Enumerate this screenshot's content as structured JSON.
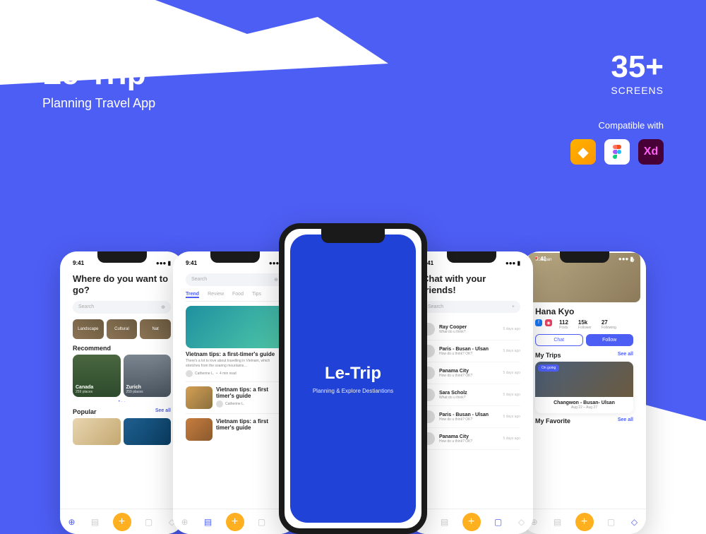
{
  "header": {
    "title": "Le-Trip",
    "subtitle": "Planning Travel App"
  },
  "badge": {
    "count": "35+",
    "label": "SCREENS"
  },
  "compat": {
    "label": "Compatible with",
    "tools": [
      "Sketch",
      "Figma",
      "Xd"
    ]
  },
  "statusTime": "9:41",
  "screen1": {
    "heading": "Where do you want to go?",
    "searchPlaceholder": "Search",
    "chips": [
      "Landscape",
      "Cultural",
      "Nat"
    ],
    "recommend": {
      "label": "Recommend",
      "items": [
        {
          "title": "Canada",
          "sub": "259 places"
        },
        {
          "title": "Zurich",
          "sub": "259 places"
        }
      ]
    },
    "popular": {
      "label": "Popular",
      "seeAll": "See all"
    }
  },
  "screen2": {
    "searchPlaceholder": "Search",
    "tabs": [
      "Trend",
      "Review",
      "Food",
      "Tips"
    ],
    "article": {
      "title": "Vietnam tips: a first-timer's guide",
      "desc": "There's a lot to love about travelling in Vietnam, which stretches from the soaring mountains…",
      "author": "Catherine L.",
      "read": "4 min read"
    },
    "rows": [
      {
        "title": "Vietnam tips: a first timer's guide",
        "author": "Catherine L."
      },
      {
        "title": "Vietnam tips: a first timer's guide"
      }
    ]
  },
  "screen3": {
    "title": "Le-Trip",
    "subtitle": "Planning & Explore Destiantions"
  },
  "screen4": {
    "heading": "Chat with your friends!",
    "searchPlaceholder": "Search",
    "chats": [
      {
        "name": "Ray Cooper",
        "msg": "What do u think?",
        "time": "5 days ago"
      },
      {
        "name": "Paris - Busan - Ulsan",
        "msg": "How do u think? OK?",
        "time": "5 days ago"
      },
      {
        "name": "Panama City",
        "msg": "How do u think? OK?",
        "time": "5 days ago"
      },
      {
        "name": "Sara Scholz",
        "msg": "What do u think?",
        "time": "5 days ago"
      },
      {
        "name": "Paris - Busan - Ulsan",
        "msg": "How do u think? OK?",
        "time": "5 days ago"
      },
      {
        "name": "Panama City",
        "msg": "How do u think? OK?",
        "time": "5 days ago"
      }
    ]
  },
  "screen5": {
    "location": "Japan",
    "name": "Hana Kyo",
    "stats": [
      {
        "n": "112",
        "l": "Posts"
      },
      {
        "n": "15k",
        "l": "Follower"
      },
      {
        "n": "27",
        "l": "Following"
      }
    ],
    "chatBtn": "Chat",
    "followBtn": "Follow",
    "myTrips": {
      "label": "My Trips",
      "seeAll": "See all"
    },
    "trip": {
      "status": "On going",
      "title": "Changwon - Busan- Ulsan",
      "date": "Aug 22 – Aug 27"
    },
    "favorite": {
      "label": "My Favorite",
      "seeAll": "See all"
    }
  }
}
